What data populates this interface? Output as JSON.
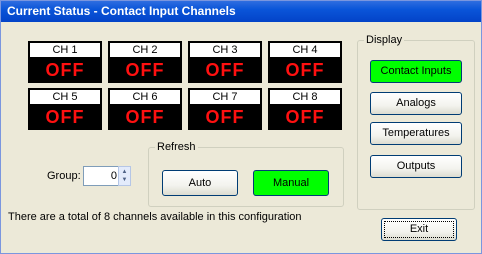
{
  "window": {
    "title": "Current Status - Contact Input Channels"
  },
  "channels": [
    {
      "label": "CH 1",
      "status": "OFF"
    },
    {
      "label": "CH 2",
      "status": "OFF"
    },
    {
      "label": "CH 3",
      "status": "OFF"
    },
    {
      "label": "CH 4",
      "status": "OFF"
    },
    {
      "label": "CH 5",
      "status": "OFF"
    },
    {
      "label": "CH 6",
      "status": "OFF"
    },
    {
      "label": "CH 7",
      "status": "OFF"
    },
    {
      "label": "CH 8",
      "status": "OFF"
    }
  ],
  "group": {
    "label": "Group:",
    "value": "0"
  },
  "refresh": {
    "legend": "Refresh",
    "auto_label": "Auto",
    "manual_label": "Manual",
    "active": "Manual"
  },
  "display": {
    "legend": "Display",
    "buttons": [
      "Contact Inputs",
      "Analogs",
      "Temperatures",
      "Outputs"
    ],
    "active": "Contact Inputs"
  },
  "footer_text": "There are a total of 8 channels available in this configuration",
  "exit_label": "Exit",
  "colors": {
    "status_off": "#ff1010",
    "active_button": "#00ff00",
    "titlebar": "#0a55d9"
  }
}
